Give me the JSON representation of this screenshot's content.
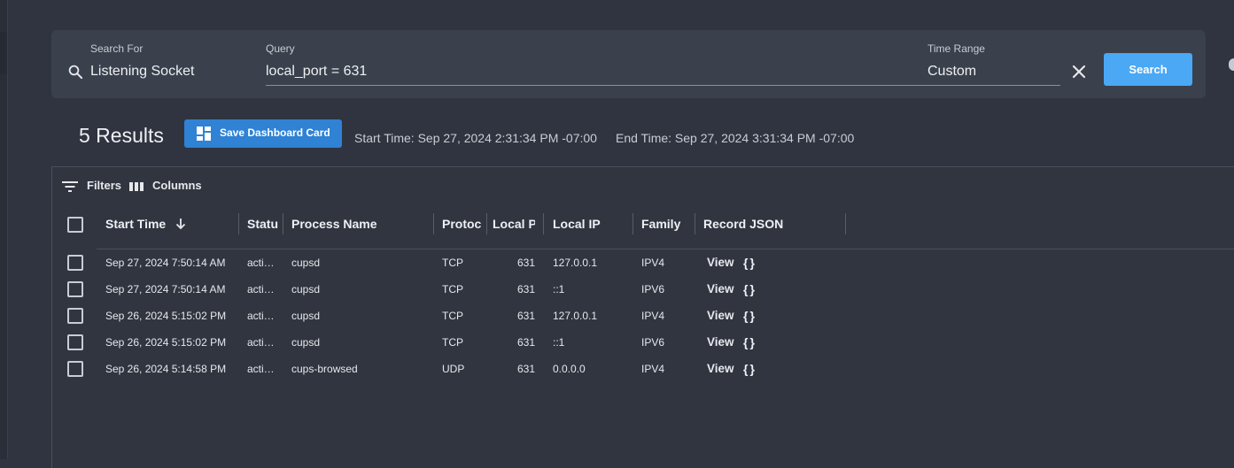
{
  "search": {
    "search_for_label": "Search For",
    "search_for_value": "Listening Socket",
    "query_label": "Query",
    "query_value": "local_port = 631",
    "time_range_label": "Time Range",
    "time_range_value": "Custom",
    "search_button": "Search"
  },
  "results": {
    "count_label": "5 Results",
    "save_card_label": "Save Dashboard Card",
    "start_time": "Start Time: Sep 27, 2024 2:31:34 PM -07:00",
    "end_time": "End Time: Sep 27, 2024 3:31:34 PM -07:00"
  },
  "toolbar": {
    "filters_label": "Filters",
    "columns_label": "Columns"
  },
  "table": {
    "headers": {
      "start_time": "Start Time",
      "status": "Status",
      "process_name": "Process Name",
      "protocol": "Protocol",
      "local_port": "Local Port",
      "local_ip": "Local IP",
      "family": "Family",
      "record_json": "Record JSON"
    },
    "view_label": "View",
    "rows": [
      {
        "start_time": "Sep 27, 2024 7:50:14 AM",
        "status": "acti…",
        "process_name": "cupsd",
        "protocol": "TCP",
        "local_port": "631",
        "local_ip": "127.0.0.1",
        "family": "IPV4"
      },
      {
        "start_time": "Sep 27, 2024 7:50:14 AM",
        "status": "acti…",
        "process_name": "cupsd",
        "protocol": "TCP",
        "local_port": "631",
        "local_ip": "::1",
        "family": "IPV6"
      },
      {
        "start_time": "Sep 26, 2024 5:15:02 PM",
        "status": "acti…",
        "process_name": "cupsd",
        "protocol": "TCP",
        "local_port": "631",
        "local_ip": "127.0.0.1",
        "family": "IPV4"
      },
      {
        "start_time": "Sep 26, 2024 5:15:02 PM",
        "status": "acti…",
        "process_name": "cupsd",
        "protocol": "TCP",
        "local_port": "631",
        "local_ip": "::1",
        "family": "IPV6"
      },
      {
        "start_time": "Sep 26, 2024 5:14:58 PM",
        "status": "acti…",
        "process_name": "cups-browsed",
        "protocol": "UDP",
        "local_port": "631",
        "local_ip": "0.0.0.0",
        "family": "IPV4"
      }
    ]
  }
}
